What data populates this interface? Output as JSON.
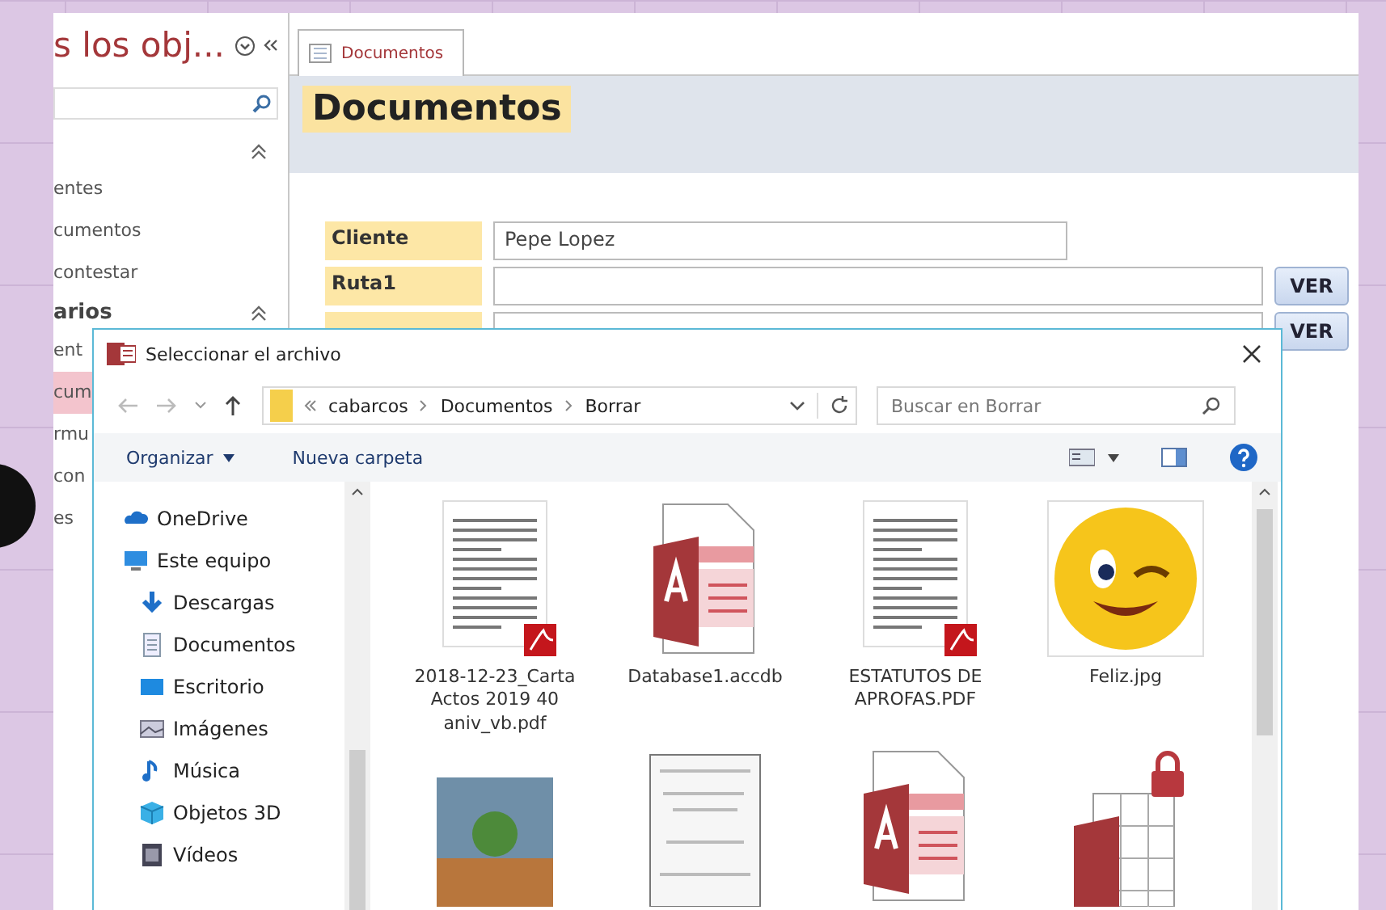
{
  "nav": {
    "title": "s los obj...",
    "groups": [
      {
        "expanded": true,
        "items": [
          {
            "label": "entes",
            "selected": false
          },
          {
            "label": "cumentos",
            "selected": false
          },
          {
            "label": "contestar",
            "selected": false
          }
        ]
      },
      {
        "label": "arios",
        "expanded": true,
        "items": [
          {
            "label": "ent",
            "selected": false
          },
          {
            "label": "cum",
            "selected": true
          },
          {
            "label": "rmu",
            "selected": false
          },
          {
            "label": "con",
            "selected": false
          },
          {
            "label": "es",
            "selected": false
          }
        ]
      }
    ]
  },
  "form": {
    "tab": {
      "label": "Documentos",
      "selected": true
    },
    "title": "Documentos",
    "fields": [
      {
        "label": "Cliente",
        "value": "Pepe Lopez"
      },
      {
        "label": "Ruta1",
        "button": "VER"
      },
      {
        "button": "VER"
      }
    ]
  },
  "dialog": {
    "title": "Seleccionar el archivo",
    "path": [
      "cabarcos",
      "Documentos",
      "Borrar"
    ],
    "search": {
      "placeholder": "Buscar en Borrar"
    },
    "toolbar": [
      {
        "label": "Organizar",
        "kind": "menu"
      },
      {
        "label": "Nueva carpeta",
        "kind": "button"
      }
    ],
    "tree": [
      {
        "label": "OneDrive",
        "kind": "cloud"
      },
      {
        "label": "Este equipo",
        "kind": "computer",
        "children": [
          {
            "label": "Descargas",
            "kind": "download"
          },
          {
            "label": "Documentos",
            "kind": "document"
          },
          {
            "label": "Escritorio",
            "kind": "desktop"
          },
          {
            "label": "Imágenes",
            "kind": "pictures"
          },
          {
            "label": "Música",
            "kind": "music"
          },
          {
            "label": "Objetos 3D",
            "kind": "cube"
          },
          {
            "label": "Vídeos",
            "kind": "video"
          }
        ]
      }
    ],
    "files": [
      {
        "name": "2018-12-23_Carta Actos 2019 40 aniv_vb.pdf",
        "kind": "pdf"
      },
      {
        "name": "Database1.accdb",
        "kind": "access"
      },
      {
        "name": "ESTATUTOS DE APROFAS.PDF",
        "kind": "pdf"
      },
      {
        "name": "Feliz.jpg",
        "kind": "emoji"
      },
      {
        "kind": "photo"
      },
      {
        "kind": "scan"
      },
      {
        "kind": "access"
      },
      {
        "kind": "access-locked"
      }
    ]
  }
}
